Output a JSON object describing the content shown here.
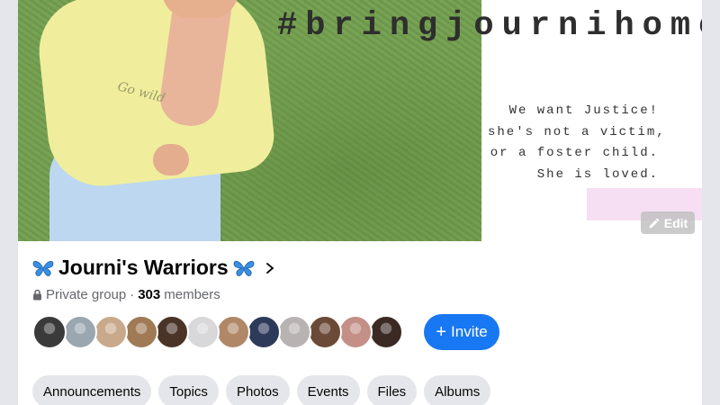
{
  "cover": {
    "hashtag": "#bringjournihome",
    "shirt_text": "Go wild",
    "message_lines": [
      "We want Justice!",
      "she's not a victim,",
      "or a foster child.",
      "She is loved."
    ],
    "edit_label": "Edit"
  },
  "group": {
    "name": "Journi's Warriors",
    "privacy": "Private group",
    "separator": "·",
    "member_count": "303",
    "members_label": "members",
    "icons": {
      "title": "butterfly-icon",
      "lock": "lock-icon",
      "chevron": "chevron-right-icon"
    }
  },
  "members": {
    "avatar_colors": [
      "#3a3a3a",
      "#9aa6b0",
      "#c9a98b",
      "#a07a55",
      "#4a3428",
      "#d8d8da",
      "#b08868",
      "#2e3a5a",
      "#b9b2b2",
      "#6b4a38",
      "#c48f86",
      "#3b2a24"
    ]
  },
  "invite": {
    "plus": "+",
    "label": "Invite",
    "color": "#1877f2"
  },
  "tabs": [
    {
      "label": "Announcements"
    },
    {
      "label": "Topics"
    },
    {
      "label": "Photos"
    },
    {
      "label": "Events"
    },
    {
      "label": "Files"
    },
    {
      "label": "Albums"
    }
  ]
}
